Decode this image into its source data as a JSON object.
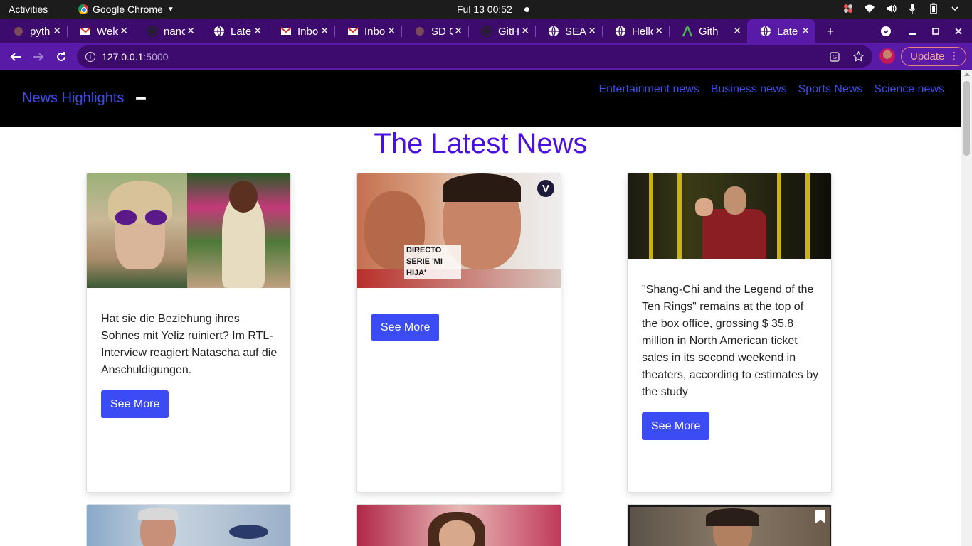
{
  "os_bar": {
    "activities": "Activities",
    "app_name": "Google Chrome",
    "clock": "Ful 13  00:52"
  },
  "browser": {
    "tabs": [
      {
        "title": "pyth",
        "icon": "generic-icon"
      },
      {
        "title": "Welc",
        "icon": "gmail-icon"
      },
      {
        "title": "nanc",
        "icon": "github-icon"
      },
      {
        "title": "Late",
        "icon": "globe-icon"
      },
      {
        "title": "Inbo",
        "icon": "gmail-icon"
      },
      {
        "title": "Inbo",
        "icon": "gmail-icon"
      },
      {
        "title": "SD C",
        "icon": "generic-icon"
      },
      {
        "title": "GitH",
        "icon": "github-icon"
      },
      {
        "title": "SEAI",
        "icon": "globe-icon"
      },
      {
        "title": "Hello",
        "icon": "globe-icon"
      },
      {
        "title": "Gith",
        "icon": "a-icon"
      },
      {
        "title": "Late",
        "icon": "globe-icon",
        "active": true
      }
    ],
    "url_host": "127.0.0.1",
    "url_port": ":5000",
    "update_label": "Update",
    "theme_color": "#5a1aa8"
  },
  "site": {
    "brand": "News Highlights",
    "nav_links": [
      "Entertainment news",
      "Business news",
      "Sports News",
      "Science news"
    ],
    "title": "The Latest News",
    "accent_color": "#3b4cf5",
    "cards": [
      {
        "text": "Hat sie die Beziehung ihres Sohnes mit Yeliz ruiniert? Im RTL-Interview reagiert Natascha auf die Anschuldigungen.",
        "button": "See More"
      },
      {
        "image_caption": "DIRECTO SERIE 'MI HIJA'",
        "badge": "V",
        "text": "",
        "button": "See More"
      },
      {
        "text": "\"Shang-Chi and the Legend of the Ten Rings\" remains at the top of the box office, grossing $ 35.8 million in North American ticket sales in its second weekend in theaters, according to estimates by the study",
        "button": "See More"
      }
    ]
  }
}
